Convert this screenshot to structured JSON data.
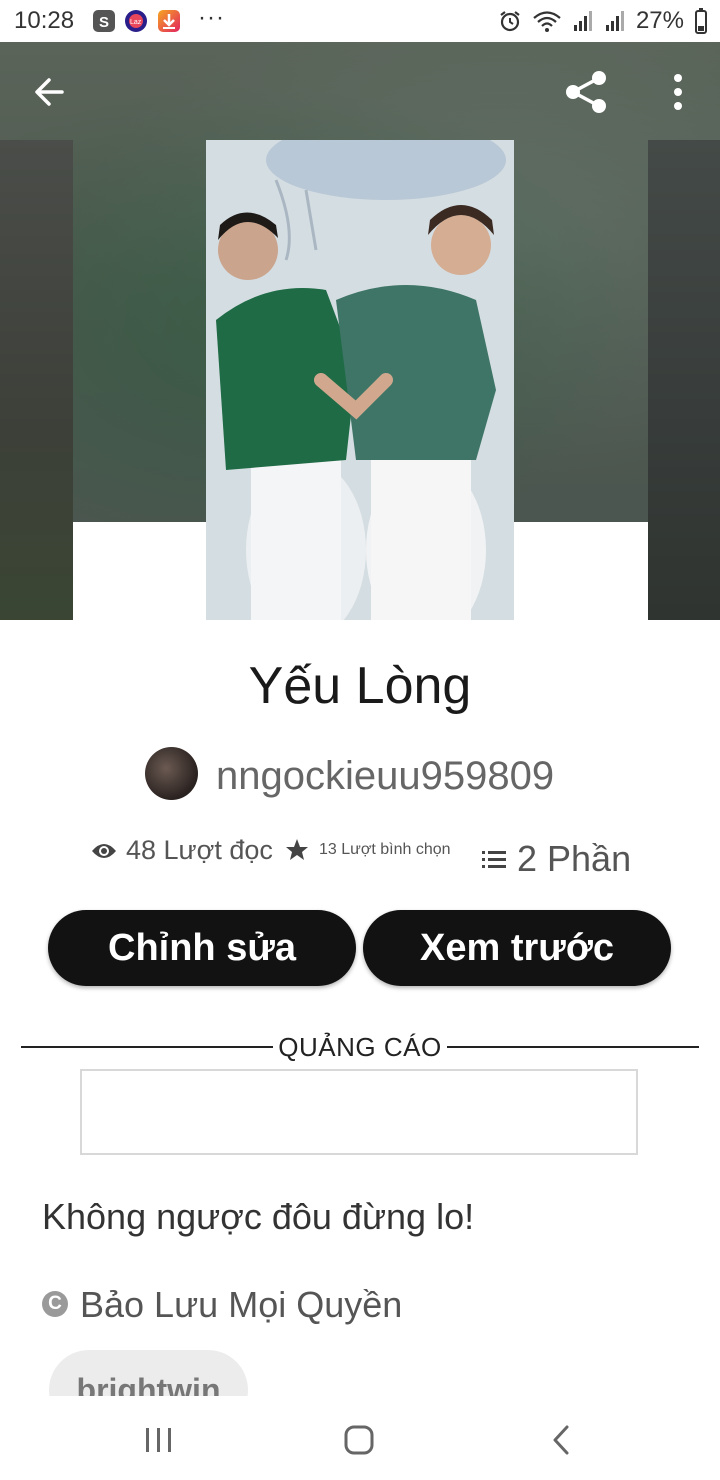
{
  "status_bar": {
    "time": "10:28",
    "battery": "27%",
    "icons": [
      "shopee-icon",
      "lazada-icon",
      "download-app-icon",
      "more-dots-icon",
      "alarm-icon",
      "wifi-icon",
      "signal-icon",
      "signal-icon",
      "battery-icon"
    ]
  },
  "toolbar": {
    "back_icon": "arrow-left-icon",
    "share_icon": "share-icon",
    "menu_icon": "more-vertical-icon"
  },
  "story": {
    "title": "Yếu Lòng",
    "author": "nngockieuu959809",
    "reads": "48 Lượt đọc",
    "votes": "13 Lượt bình chọn",
    "parts": "2 Phần",
    "description": "Không ngược đôu đừng lo!",
    "copyright": "Bảo Lưu Mọi Quyền",
    "tag": "brightwin"
  },
  "actions": {
    "edit_label": "Chỉnh sửa",
    "preview_label": "Xem trước"
  },
  "ad": {
    "label": "QUẢNG CÁO"
  }
}
